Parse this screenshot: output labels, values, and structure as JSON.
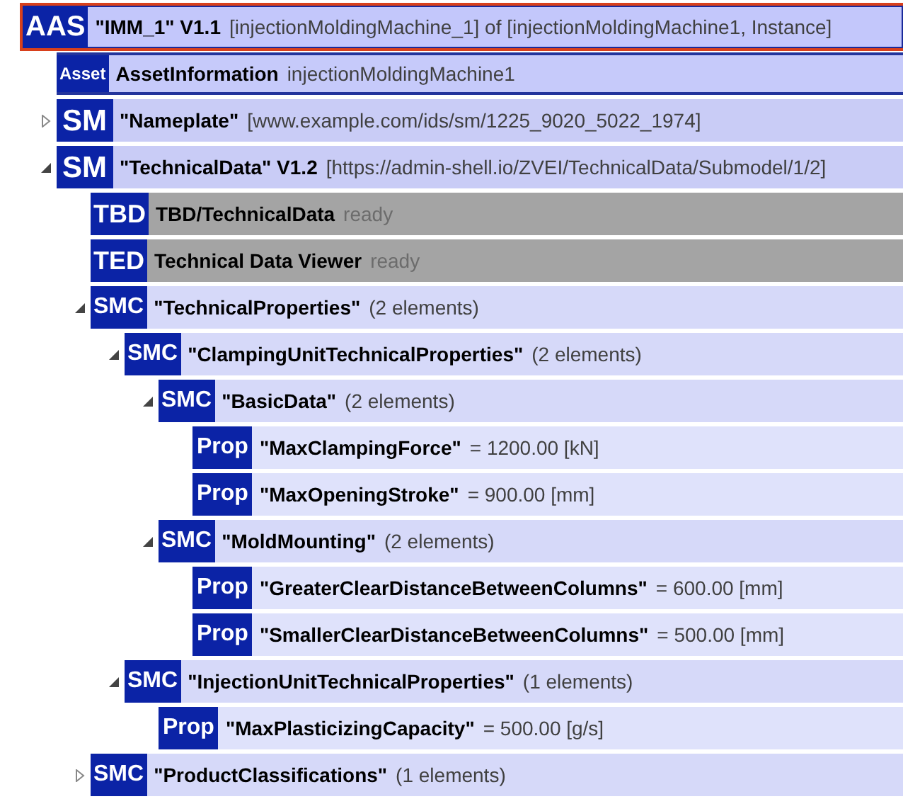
{
  "tree": [
    {
      "kind": "aas",
      "badge": "AAS",
      "name": "\"IMM_1\" V1.1",
      "info": "[injectionMoldingMachine_1] of [injectionMoldingMachine1, Instance]",
      "selected": true,
      "children": [
        {
          "kind": "asset",
          "badge": "Asset",
          "name": "AssetInformation",
          "info": "injectionMoldingMachine1",
          "selected": false
        },
        {
          "kind": "sm",
          "badge": "SM",
          "name": "\"Nameplate\"",
          "info": "[www.example.com/ids/sm/1225_9020_5022_1974]",
          "selected": false,
          "expanded": false
        },
        {
          "kind": "sm",
          "badge": "SM",
          "name": "\"TechnicalData\" V1.2",
          "info": "[https://admin-shell.io/ZVEI/TechnicalData/Submodel/1/2]",
          "selected": false,
          "expanded": true,
          "children": [
            {
              "kind": "plugin",
              "badge": "TBD",
              "name": "TBD/TechnicalData",
              "info": "ready",
              "selected": false
            },
            {
              "kind": "plugin",
              "badge": "TED",
              "name": "Technical Data Viewer",
              "info": "ready",
              "selected": false
            },
            {
              "kind": "smc",
              "badge": "SMC",
              "name": "\"TechnicalProperties\"",
              "info": "(2 elements)",
              "selected": false,
              "expanded": true,
              "children": [
                {
                  "kind": "smc",
                  "badge": "SMC",
                  "name": "\"ClampingUnitTechnicalProperties\"",
                  "info": "(2 elements)",
                  "selected": false,
                  "expanded": true,
                  "children": [
                    {
                      "kind": "smc",
                      "badge": "SMC",
                      "name": "\"BasicData\"",
                      "info": "(2 elements)",
                      "selected": false,
                      "expanded": true,
                      "children": [
                        {
                          "kind": "prop",
                          "badge": "Prop",
                          "name": "\"MaxClampingForce\"",
                          "info": "= 1200.00 [kN]",
                          "selected": false
                        },
                        {
                          "kind": "prop",
                          "badge": "Prop",
                          "name": "\"MaxOpeningStroke\"",
                          "info": "= 900.00 [mm]",
                          "selected": false
                        }
                      ]
                    },
                    {
                      "kind": "smc",
                      "badge": "SMC",
                      "name": "\"MoldMounting\"",
                      "info": "(2 elements)",
                      "selected": false,
                      "expanded": true,
                      "children": [
                        {
                          "kind": "prop",
                          "badge": "Prop",
                          "name": "\"GreaterClearDistanceBetweenColumns\"",
                          "info": "= 600.00 [mm]",
                          "selected": false
                        },
                        {
                          "kind": "prop",
                          "badge": "Prop",
                          "name": "\"SmallerClearDistanceBetweenColumns\"",
                          "info": "= 500.00 [mm]",
                          "selected": false
                        }
                      ]
                    }
                  ]
                },
                {
                  "kind": "smc",
                  "badge": "SMC",
                  "name": "\"InjectionUnitTechnicalProperties\"",
                  "info": "(1 elements)",
                  "selected": false,
                  "expanded": true,
                  "children": [
                    {
                      "kind": "prop",
                      "badge": "Prop",
                      "name": "\"MaxPlasticizingCapacity\"",
                      "info": "= 500.00 [g/s]",
                      "selected": false
                    }
                  ]
                }
              ]
            },
            {
              "kind": "smc",
              "badge": "SMC",
              "name": "\"ProductClassifications\"",
              "info": "(1 elements)",
              "selected": false,
              "expanded": false
            }
          ]
        }
      ]
    }
  ]
}
